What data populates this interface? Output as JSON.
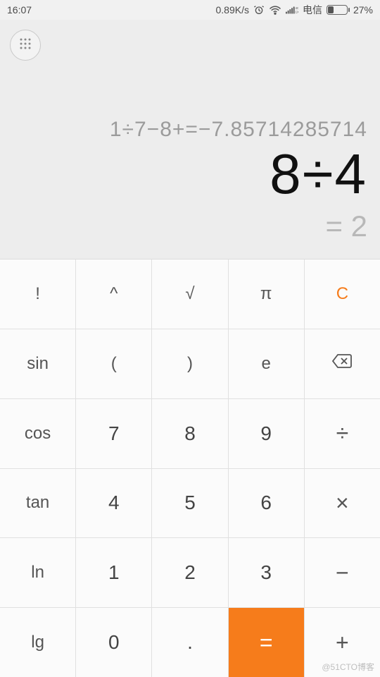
{
  "status": {
    "time": "16:07",
    "netspeed": "0.89K/s",
    "carrier": "电信",
    "battery_pct": "27%"
  },
  "display": {
    "history": "1÷7−8+=−7.85714285714",
    "expression": "8÷4",
    "result": "= 2"
  },
  "keys": {
    "r0": {
      "fact": "!",
      "pow": "^",
      "sqrt": "√",
      "pi": "π",
      "clear": "C"
    },
    "r1": {
      "sin": "sin",
      "lpar": "(",
      "rpar": ")",
      "e": "e",
      "bksp": "⌫"
    },
    "r2": {
      "cos": "cos",
      "k7": "7",
      "k8": "8",
      "k9": "9",
      "div": "÷"
    },
    "r3": {
      "tan": "tan",
      "k4": "4",
      "k5": "5",
      "k6": "6",
      "mul": "×"
    },
    "r4": {
      "ln": "ln",
      "k1": "1",
      "k2": "2",
      "k3": "3",
      "sub": "−"
    },
    "r5": {
      "lg": "lg",
      "k0": "0",
      "dot": ".",
      "eq": "=",
      "add": "+"
    }
  },
  "watermark": "@51CTO博客"
}
